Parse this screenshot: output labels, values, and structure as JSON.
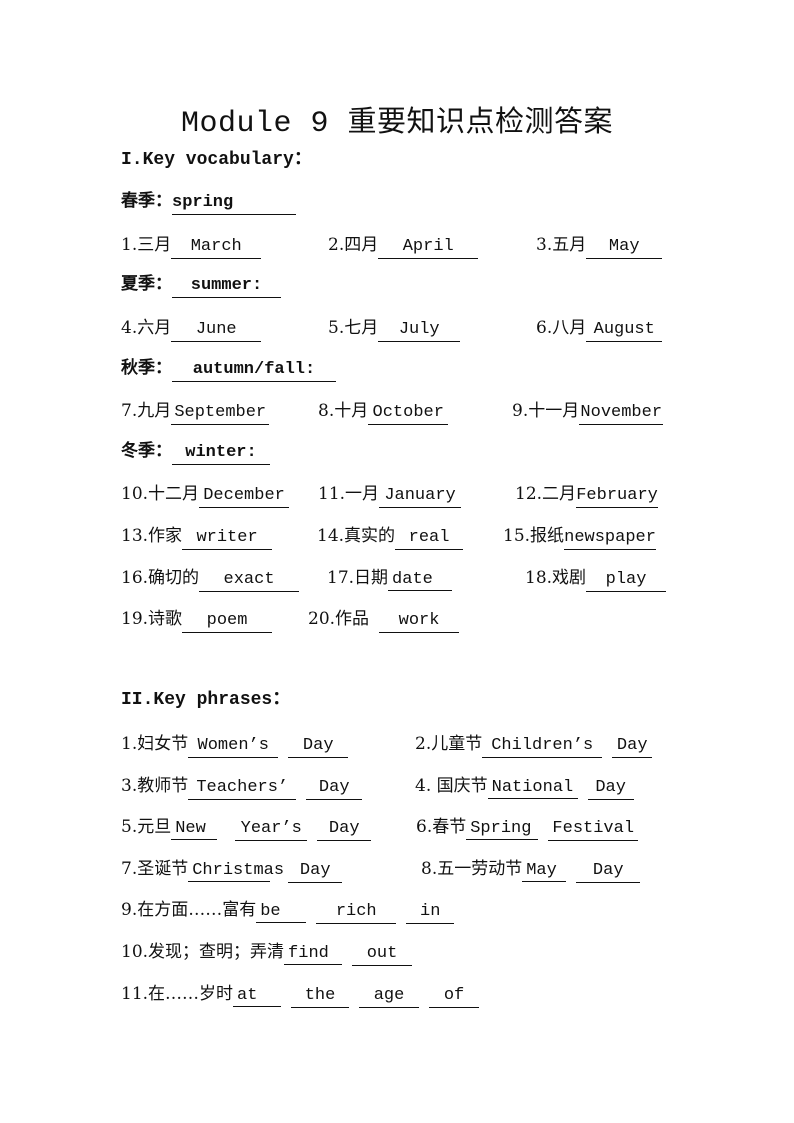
{
  "title": {
    "en": "Module 9",
    "cn": "重要知识点检测答案"
  },
  "section1": {
    "heading": "I.Key vocabulary：",
    "seasons": {
      "spring": {
        "label": "春季：",
        "answer": "spring"
      },
      "summer": {
        "label": "夏季：",
        "answer": "summer:"
      },
      "autumn": {
        "label": "秋季：",
        "answer": "autumn/fall:"
      },
      "winter": {
        "label": "冬季：",
        "answer": "winter:"
      }
    },
    "items": [
      {
        "label": "1.三月",
        "answer": "March"
      },
      {
        "label": "2.四月",
        "answer": "April"
      },
      {
        "label": "3.五月",
        "answer": "May"
      },
      {
        "label": "4.六月",
        "answer": "June"
      },
      {
        "label": "5.七月",
        "answer": "July"
      },
      {
        "label": "6.八月",
        "answer": "August"
      },
      {
        "label": "7.九月",
        "answer": "September"
      },
      {
        "label": "8.十月",
        "answer": "October"
      },
      {
        "label": "9.十一月",
        "answer": "November"
      },
      {
        "label": "10.十二月",
        "answer": "December"
      },
      {
        "label": "11.一月",
        "answer": "January"
      },
      {
        "label": "12.二月",
        "answer": "February"
      },
      {
        "label": "13.作家",
        "answer": "writer"
      },
      {
        "label": "14.真实的",
        "answer": "real"
      },
      {
        "label": "15.报纸",
        "answer": "newspaper"
      },
      {
        "label": "16.确切的",
        "answer": "exact"
      },
      {
        "label": "17.日期",
        "answer": "date"
      },
      {
        "label": "18.戏剧",
        "answer": "play"
      },
      {
        "label": "19.诗歌",
        "answer": "poem"
      },
      {
        "label": "20.作品",
        "answer": "work"
      }
    ]
  },
  "section2": {
    "heading": "II.Key phrases：",
    "items": [
      {
        "label": "1.妇女节",
        "answers": [
          "Women’s",
          "Day"
        ]
      },
      {
        "label": "2.儿童节",
        "answers": [
          "Children’s",
          "Day"
        ]
      },
      {
        "label": "3.教师节",
        "answers": [
          "Teachers’",
          "Day"
        ]
      },
      {
        "label": "4. 国庆节",
        "answers": [
          "National",
          "Day"
        ]
      },
      {
        "label": "5.元旦",
        "answers": [
          "New",
          "Year’s",
          "Day"
        ]
      },
      {
        "label": "6.春节",
        "answers": [
          "Spring",
          "Festival"
        ]
      },
      {
        "label": "7.圣诞节",
        "answers": [
          "Christmas",
          "Day"
        ]
      },
      {
        "label": "8.五一劳动节",
        "answers": [
          "May",
          "Day"
        ]
      },
      {
        "label": "9.在方面……富有",
        "answers": [
          "be",
          "rich",
          "in"
        ]
      },
      {
        "label": "10.发现；查明；弄清",
        "answers": [
          "find",
          "out"
        ]
      },
      {
        "label": "11.在……岁时",
        "answers": [
          "at",
          "the",
          "age",
          "of"
        ]
      }
    ]
  }
}
